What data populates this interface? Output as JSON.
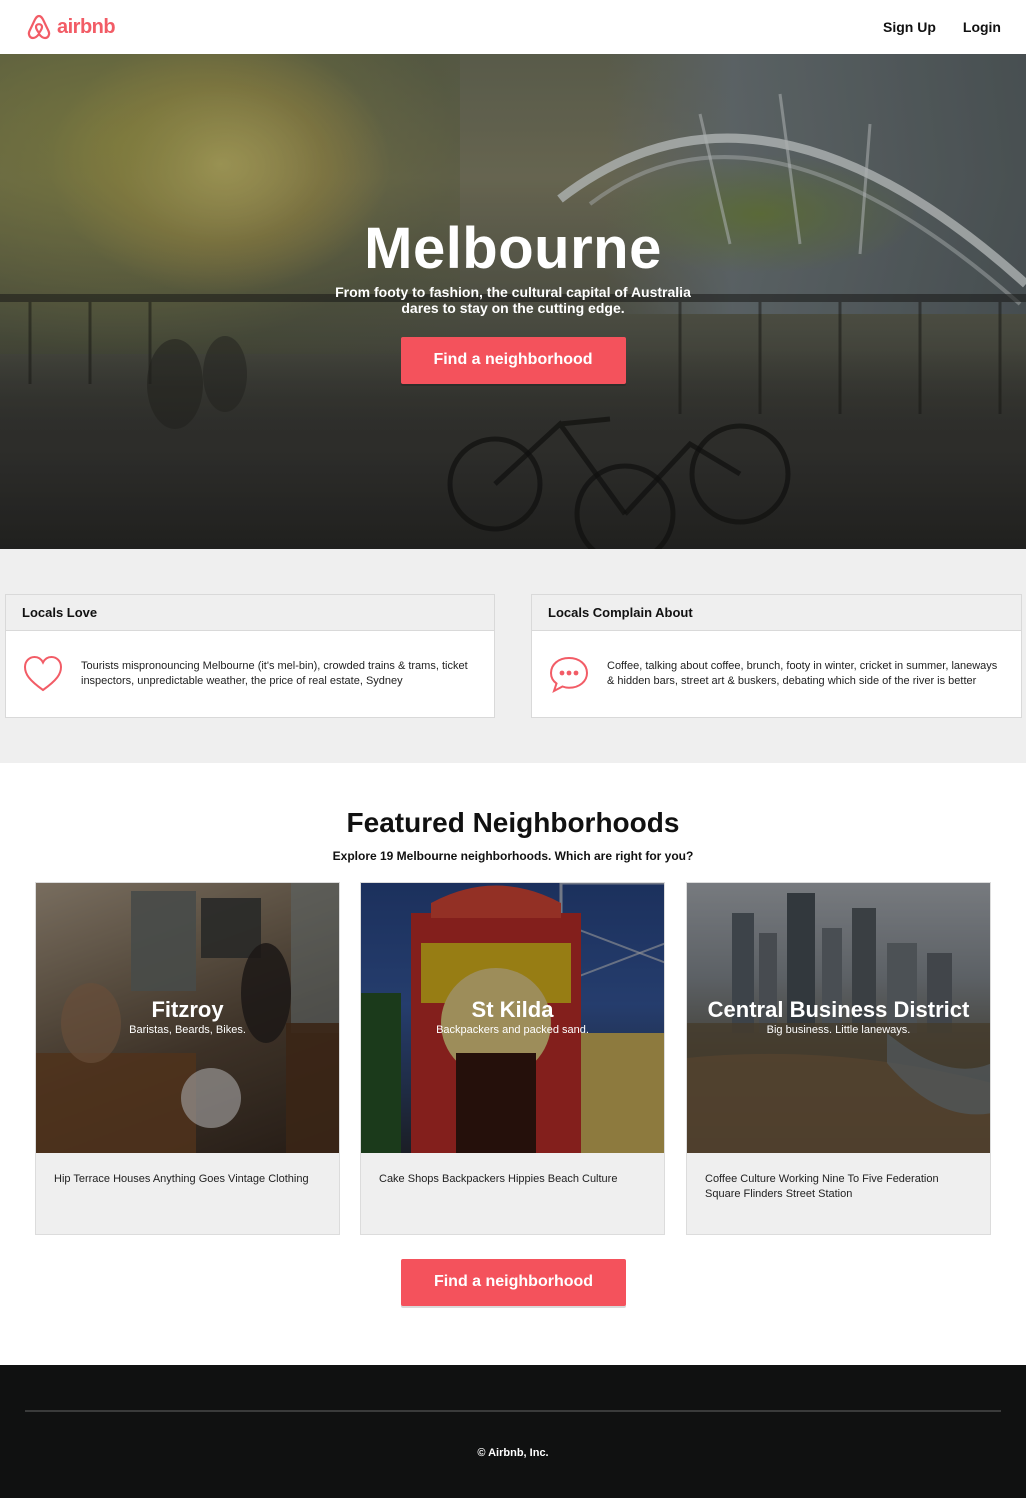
{
  "header": {
    "brand": "airbnb",
    "nav": {
      "signup": "Sign Up",
      "login": "Login"
    }
  },
  "hero": {
    "title": "Melbourne",
    "subtitle": "From footy to fashion, the cultural capital of Australia dares to stay on the cutting edge.",
    "cta": "Find a neighborhood"
  },
  "locals": {
    "love": {
      "heading": "Locals Love",
      "icon": "heart-icon",
      "text": "Tourists mispronouncing Melbourne (it's mel-bin), crowded trains & trams, ticket inspectors, unpredictable weather, the price of real estate, Sydney"
    },
    "complain": {
      "heading": "Locals Complain About",
      "icon": "speech-bubble-icon",
      "text": "Coffee, talking about coffee, brunch, footy in winter, cricket in summer, laneways & hidden bars, street art & buskers, debating which side of the river is better"
    }
  },
  "featured": {
    "title": "Featured Neighborhoods",
    "subtitle": "Explore 19 Melbourne neighborhoods. Which are right for you?",
    "neighborhoods": [
      {
        "name": "Fitzroy",
        "tagline": "Baristas, Beards, Bikes.",
        "tags": "Hip Terrace Houses Anything Goes Vintage Clothing"
      },
      {
        "name": "St Kilda",
        "tagline": "Backpackers and packed sand.",
        "tags": "Cake Shops Backpackers Hippies Beach Culture"
      },
      {
        "name": "Central Business District",
        "tagline": "Big business. Little laneways.",
        "tags": "Coffee Culture Working Nine To Five Federation Square Flinders Street Station"
      }
    ],
    "cta": "Find a neighborhood"
  },
  "footer": {
    "copyright": "© Airbnb, Inc."
  },
  "colors": {
    "brand": "#f25c66",
    "button": "#f4525c",
    "section_gray": "#efefef",
    "footer": "#101111"
  }
}
